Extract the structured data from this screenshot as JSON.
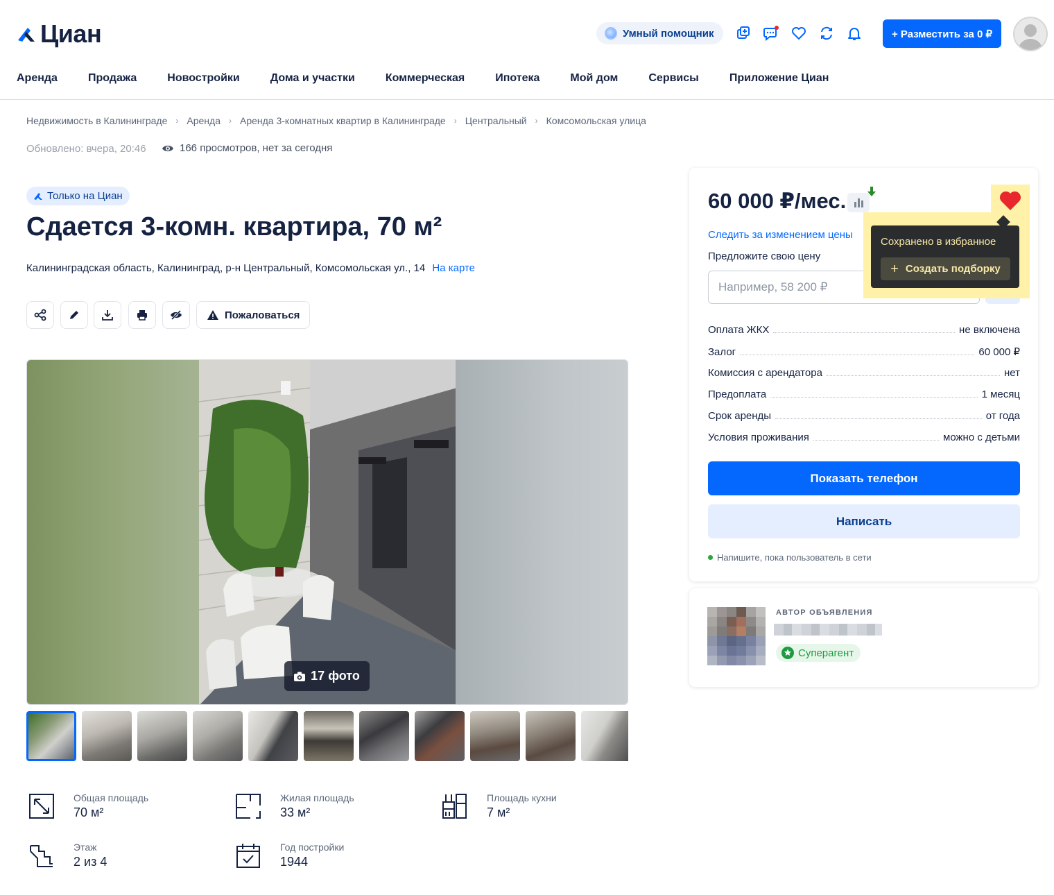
{
  "header": {
    "logo_text": "Циан",
    "assistant_label": "Умный помощник",
    "post_button": "+ Разместить за 0 ₽"
  },
  "nav": [
    "Аренда",
    "Продажа",
    "Новостройки",
    "Дома и участки",
    "Коммерческая",
    "Ипотека",
    "Мой дом",
    "Сервисы",
    "Приложение Циан"
  ],
  "breadcrumbs": [
    "Недвижимость в Калининграде",
    "Аренда",
    "Аренда 3-комнатных квартир в Калининграде",
    "Центральный",
    "Комсомольская улица"
  ],
  "meta": {
    "updated": "Обновлено: вчера, 20:46",
    "views": "166 просмотров, нет за сегодня"
  },
  "listing": {
    "badge": "Только на Циан",
    "title": "Сдается 3-комн. квартира, 70 м²",
    "address": "Калининградская область, Калининград, р-н Центральный, Комсомольская ул., 14",
    "map_link": "На карте",
    "report_button": "Пожаловаться",
    "photo_count": "17 фото"
  },
  "features": [
    {
      "label": "Общая площадь",
      "value": "70 м²",
      "icon": "area-icon"
    },
    {
      "label": "Жилая площадь",
      "value": "33 м²",
      "icon": "living-area-icon"
    },
    {
      "label": "Площадь кухни",
      "value": "7 м²",
      "icon": "kitchen-icon"
    },
    {
      "label": "Этаж",
      "value": "2 из 4",
      "icon": "stairs-icon"
    },
    {
      "label": "Год постройки",
      "value": "1944",
      "icon": "calendar-icon"
    }
  ],
  "price_card": {
    "price": "60 000 ₽/мес.",
    "follow_price": "Следить за изменением цены",
    "suggest_price": "Предложите свою цену",
    "input_placeholder": "Например, 58 200 ₽",
    "terms": [
      {
        "label": "Оплата ЖКХ",
        "value": "не включена"
      },
      {
        "label": "Залог",
        "value": "60 000 ₽"
      },
      {
        "label": "Комиссия с арендатора",
        "value": "нет"
      },
      {
        "label": "Предоплата",
        "value": "1 месяц"
      },
      {
        "label": "Срок аренды",
        "value": "от года"
      },
      {
        "label": "Условия проживания",
        "value": "можно с детьми"
      }
    ],
    "show_phone": "Показать телефон",
    "write": "Написать",
    "online_hint": "Напишите, пока пользователь в сети"
  },
  "tooltip": {
    "saved": "Сохранено в избранное",
    "create_collection": "Создать подборку"
  },
  "author": {
    "label": "АВТОР ОБЪЯВЛЕНИЯ",
    "badge": "Суперагент"
  },
  "colors": {
    "brand": "#0468ff",
    "text": "#152242",
    "heart": "#e8282c",
    "highlight": "#fff2a8"
  }
}
